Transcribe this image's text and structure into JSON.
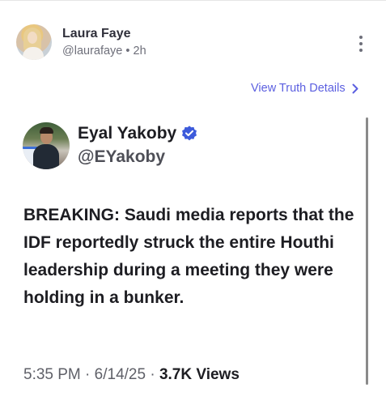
{
  "post": {
    "author_name": "Laura Faye",
    "author_handle": "@laurafaye",
    "separator": "•",
    "time_ago": "2h"
  },
  "truth_link": {
    "label": "View Truth Details"
  },
  "embedded_tweet": {
    "author_name": "Eyal Yakoby",
    "author_handle": "@EYakoby",
    "verified": true,
    "text": "BREAKING: Saudi media reports that the IDF reportedly struck the entire Houthi leadership during a meeting they were holding in a bunker.",
    "time": "5:35 PM",
    "date": "6/14/25",
    "dot": "·",
    "views_count": "3.7K",
    "views_label": "Views"
  },
  "colors": {
    "accent": "#5b5fe0",
    "verified": "#3d5bdb",
    "text_primary": "#1d1d22",
    "text_secondary": "#6e6f7a"
  },
  "icons": {
    "more": "vertical-ellipsis-icon",
    "link_chevron": "chevron-right-icon",
    "verified": "verified-badge-icon"
  }
}
